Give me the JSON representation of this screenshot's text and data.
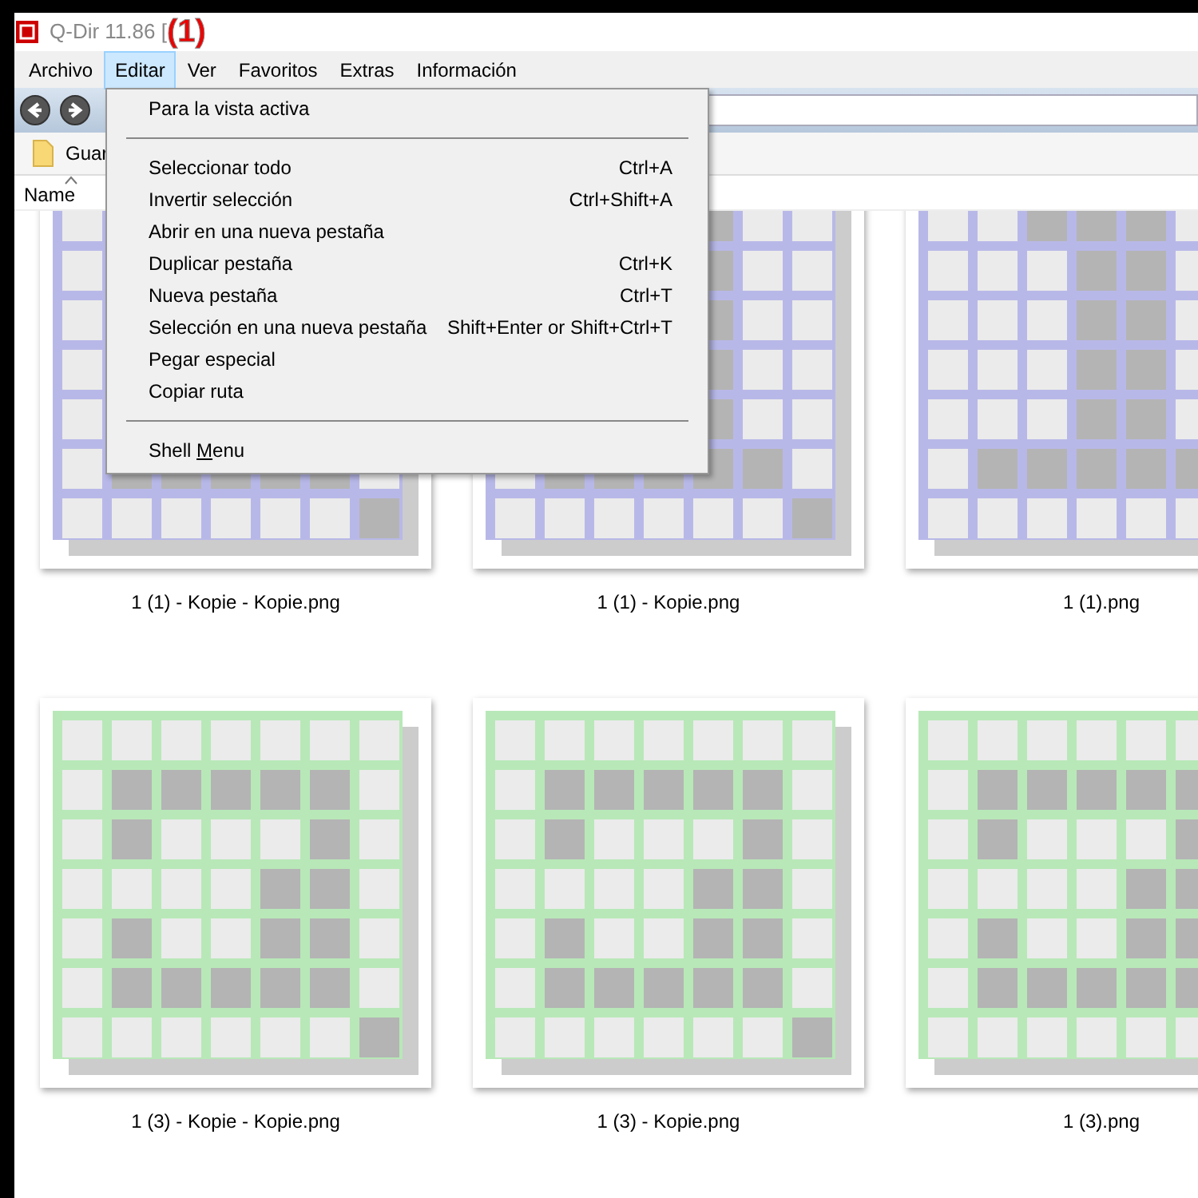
{
  "window": {
    "title": "Q-Dir 11.86 [",
    "annotation": "(1)"
  },
  "menu_bar": [
    {
      "label": "Archivo",
      "selected": false
    },
    {
      "label": "Editar",
      "selected": true
    },
    {
      "label": "Ver",
      "selected": false
    },
    {
      "label": "Favoritos",
      "selected": false
    },
    {
      "label": "Extras",
      "selected": false
    },
    {
      "label": "Información",
      "selected": false
    }
  ],
  "address_bar": {
    "folder": "Guar"
  },
  "column_header": {
    "label": "Name",
    "sorted_ascending": true
  },
  "files": [
    {
      "name": "1 (1) - Kopie - Kopie.png",
      "color": "#b8b8e8",
      "kind": "one"
    },
    {
      "name": "1 (1) - Kopie.png",
      "color": "#b8b8e8",
      "kind": "one"
    },
    {
      "name": "1 (1).png",
      "color": "#b8b8e8",
      "kind": "one"
    },
    {
      "name": "1 (3) - Kopie - Kopie.png",
      "color": "#b8e8b8",
      "kind": "three"
    },
    {
      "name": "1 (3) - Kopie.png",
      "color": "#b8e8b8",
      "kind": "three"
    },
    {
      "name": "1 (3).png",
      "color": "#b8e8b8",
      "kind": "three"
    }
  ],
  "dropdown_menu": [
    {
      "kind": "item",
      "label": "Para la vista activa"
    },
    {
      "kind": "separator"
    },
    {
      "kind": "item",
      "label": "Seleccionar todo",
      "shortcut": "Ctrl+A"
    },
    {
      "kind": "item",
      "label": "Invertir selección",
      "shortcut": "Ctrl+Shift+A"
    },
    {
      "kind": "item",
      "label": "Abrir en una nueva pestaña"
    },
    {
      "kind": "item",
      "label": "Duplicar pestaña",
      "shortcut": "Ctrl+K"
    },
    {
      "kind": "item",
      "label": "Nueva pestaña",
      "shortcut": "Ctrl+T"
    },
    {
      "kind": "item",
      "label": "Selección en una nueva pestaña",
      "shortcut": "Shift+Enter or Shift+Ctrl+T"
    },
    {
      "kind": "item",
      "label": "Pegar especial"
    },
    {
      "kind": "item",
      "label": "Copiar ruta"
    },
    {
      "kind": "separator"
    },
    {
      "kind": "item",
      "label": "Shell Menu",
      "mnemonic_underlined": true
    }
  ]
}
